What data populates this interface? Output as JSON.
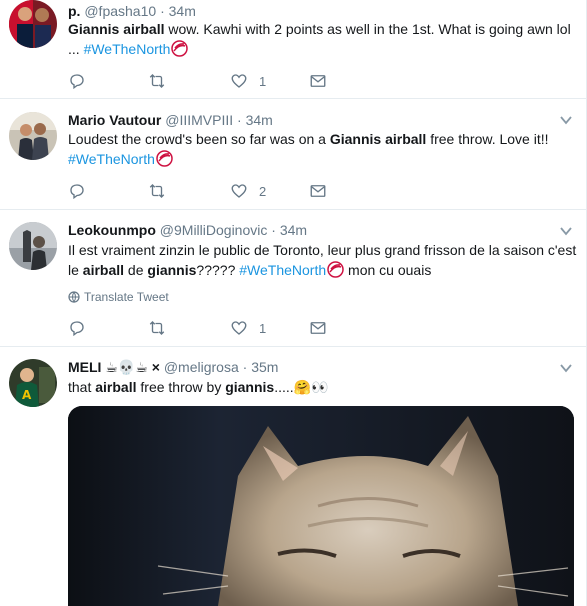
{
  "tweets": [
    {
      "fullname": "p.",
      "handle": "@fpasha10",
      "dot": "·",
      "time": "34m",
      "text_bold": "Giannis airball",
      "text_rest": " wow. Kawhi with 2 points as well in the 1st. What is going awn lol",
      "text_line2": "... ",
      "hashtag": "#WeTheNorth",
      "likes": "1"
    },
    {
      "fullname": "Mario Vautour",
      "handle": "@IIIMVPIII",
      "dot": "·",
      "time": "34m",
      "text_pre": "Loudest the crowd's been so far was on a ",
      "text_bold": "Giannis airball",
      "text_post": " free throw. Love it!!",
      "hashtag": "#WeTheNorth",
      "likes": "2"
    },
    {
      "fullname": "Leokounmpo",
      "handle": "@9MilliDoginovic",
      "dot": "·",
      "time": "34m",
      "text_line1": "Il est vraiment zinzin le public de Toronto, leur plus grand frisson de la saison c'est",
      "text_pre": "le ",
      "text_bold1": "airball",
      "text_mid": " de ",
      "text_bold2": "giannis",
      "text_q": "????? ",
      "hashtag": "#WeTheNorth",
      "text_post": " mon cu ouais",
      "translate": "Translate Tweet",
      "likes": "1"
    },
    {
      "fullname": "MELI ☕💀☕ ×",
      "handle": "@meligrosa",
      "dot": "·",
      "time": "35m",
      "text_pre": "that ",
      "text_bold1": "airball",
      "text_mid": " free throw by ",
      "text_bold2": "giannis",
      "text_post": ".....🤗👀"
    }
  ],
  "colors": {
    "hashtag": "#1b95e0",
    "secondary_text": "#657786",
    "divider": "#e6ecf0"
  },
  "icons": [
    "reply-icon",
    "retweet-icon",
    "like-icon",
    "direct-message-icon",
    "chevron-down-icon",
    "globe-icon",
    "raptors-emoji-icon"
  ]
}
